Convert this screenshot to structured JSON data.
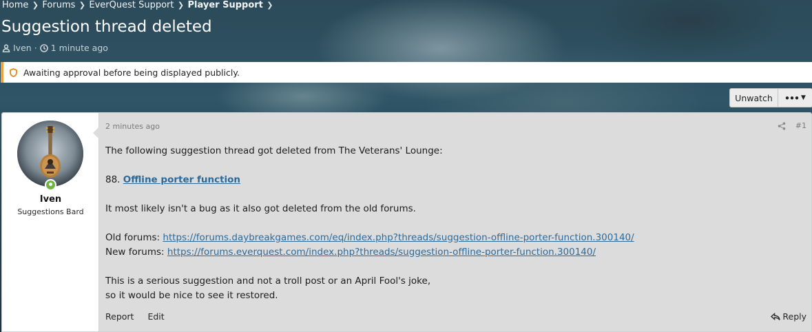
{
  "breadcrumb": {
    "items": [
      {
        "label": "Home"
      },
      {
        "label": "Forums"
      },
      {
        "label": "EverQuest Support"
      },
      {
        "label": "Player Support"
      }
    ]
  },
  "thread": {
    "title": "Suggestion thread deleted",
    "author": "Iven",
    "separator": "·",
    "time_ago": "1 minute ago"
  },
  "notice": {
    "text": "Awaiting approval before being displayed publicly."
  },
  "buttons": {
    "unwatch": "Unwatch",
    "more": "•••"
  },
  "post": {
    "username": "Iven",
    "user_title": "Suggestions Bard",
    "date": "2 minutes ago",
    "number": "#1",
    "body": {
      "line1": "The following suggestion thread got deleted from The Veterans' Lounge:",
      "item_prefix": "88. ",
      "item_link": "Offline porter function",
      "line3": "It most likely isn't a bug as it also got deleted from the old forums.",
      "old_label": "Old forums: ",
      "old_url": "https://forums.daybreakgames.com/eq/index.php?threads/suggestion-offline-porter-function.300140/",
      "new_label": "New forums: ",
      "new_url": "https://forums.everquest.com/index.php?threads/suggestion-offline-porter-function.300140/",
      "line5a": "This is a serious suggestion and not a troll post or an April Fool's joke,",
      "line5b": "so it would be nice to see it restored."
    },
    "actions": {
      "report": "Report",
      "edit": "Edit",
      "reply": "Reply"
    }
  },
  "colors": {
    "notice_accent": "#f0a13a",
    "link": "#2c6a9a",
    "online": "#6fb543",
    "post_bg": "#dcdcdc"
  },
  "icons": [
    "chevron-right-icon",
    "user-icon",
    "clock-icon",
    "shield-icon",
    "share-icon",
    "reply-icon",
    "caret-down-icon"
  ]
}
